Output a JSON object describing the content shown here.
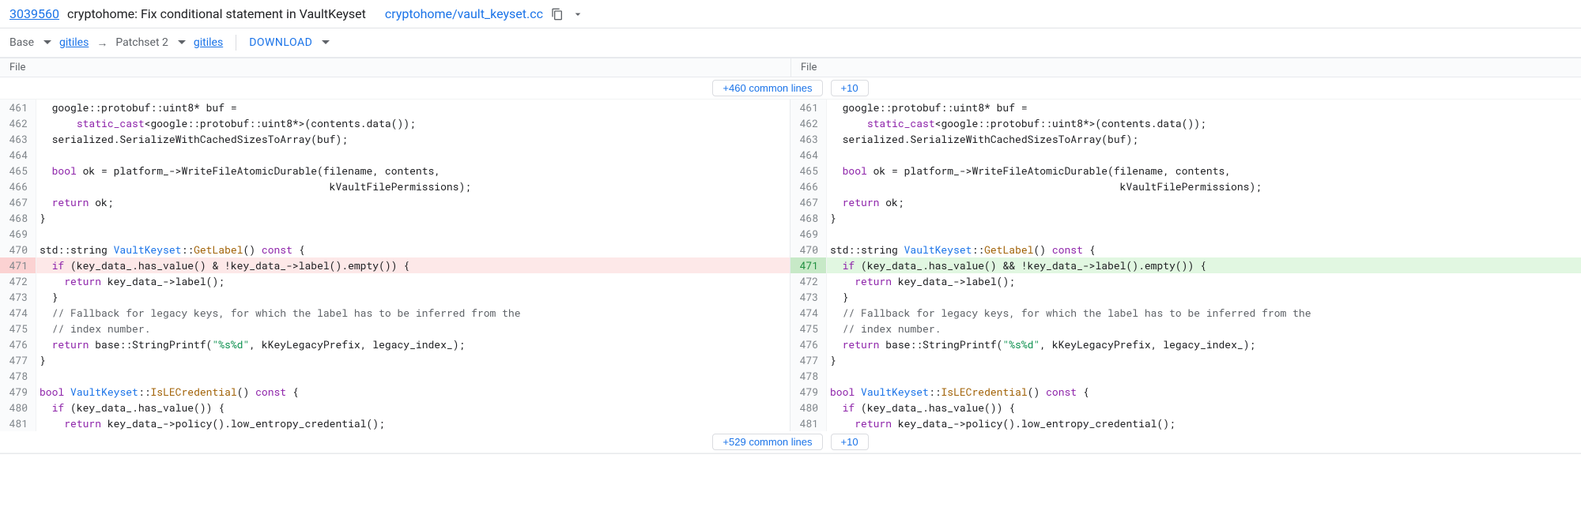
{
  "header": {
    "change_id": "3039560",
    "title": "cryptohome: Fix conditional statement in VaultKeyset",
    "file_path": "cryptohome/vault_keyset.cc"
  },
  "secondary": {
    "base_label": "Base",
    "gitiles_left": "gitiles",
    "arrow": "→",
    "patchset_label": "Patchset 2",
    "gitiles_right": "gitiles",
    "download": "DOWNLOAD"
  },
  "headings": {
    "left": "File",
    "right": "File"
  },
  "expand_top": {
    "common": "+460 common lines",
    "more": "+10"
  },
  "expand_bottom": {
    "common": "+529 common lines",
    "more": "+10"
  },
  "diff_left": [
    {
      "n": "461",
      "t": "none",
      "html": "  google::protobuf::uint8* buf ="
    },
    {
      "n": "462",
      "t": "none",
      "html": "      <span class='kw'>static_cast</span>&lt;google::protobuf::uint8*&gt;(contents.data());"
    },
    {
      "n": "463",
      "t": "none",
      "html": "  serialized.SerializeWithCachedSizesToArray(buf);"
    },
    {
      "n": "464",
      "t": "none",
      "html": ""
    },
    {
      "n": "465",
      "t": "none",
      "html": "  <span class='kw'>bool</span> ok = platform_-&gt;WriteFileAtomicDurable(filename, contents,"
    },
    {
      "n": "466",
      "t": "none",
      "html": "                                               kVaultFilePermissions);"
    },
    {
      "n": "467",
      "t": "none",
      "html": "  <span class='kw'>return</span> ok;"
    },
    {
      "n": "468",
      "t": "none",
      "html": "}"
    },
    {
      "n": "469",
      "t": "none",
      "html": ""
    },
    {
      "n": "470",
      "t": "none",
      "html": "std::string <span class='type'>VaultKeyset</span>::<span class='func'>GetLabel</span>() <span class='kw'>const</span> {"
    },
    {
      "n": "471",
      "t": "del",
      "html": "  <span class='kw'>if</span> (key_data_.has_value() &amp; !key_data_-&gt;label().empty()) {"
    },
    {
      "n": "472",
      "t": "none",
      "html": "    <span class='kw'>return</span> key_data_-&gt;label();"
    },
    {
      "n": "473",
      "t": "none",
      "html": "  }"
    },
    {
      "n": "474",
      "t": "none",
      "html": "  <span class='cmt'>// Fallback for legacy keys, for which the label has to be inferred from the</span>"
    },
    {
      "n": "475",
      "t": "none",
      "html": "  <span class='cmt'>// index number.</span>"
    },
    {
      "n": "476",
      "t": "none",
      "html": "  <span class='kw'>return</span> base::StringPrintf(<span class='str'>\"%s%d\"</span>, kKeyLegacyPrefix, legacy_index_);"
    },
    {
      "n": "477",
      "t": "none",
      "html": "}"
    },
    {
      "n": "478",
      "t": "none",
      "html": ""
    },
    {
      "n": "479",
      "t": "none",
      "html": "<span class='kw'>bool</span> <span class='type'>VaultKeyset</span>::<span class='func'>IsLECredential</span>() <span class='kw'>const</span> {"
    },
    {
      "n": "480",
      "t": "none",
      "html": "  <span class='kw'>if</span> (key_data_.has_value()) {"
    },
    {
      "n": "481",
      "t": "none",
      "html": "    <span class='kw'>return</span> key_data_-&gt;policy().low_entropy_credential();"
    }
  ],
  "diff_right": [
    {
      "n": "461",
      "t": "none",
      "html": "  google::protobuf::uint8* buf ="
    },
    {
      "n": "462",
      "t": "none",
      "html": "      <span class='kw'>static_cast</span>&lt;google::protobuf::uint8*&gt;(contents.data());"
    },
    {
      "n": "463",
      "t": "none",
      "html": "  serialized.SerializeWithCachedSizesToArray(buf);"
    },
    {
      "n": "464",
      "t": "none",
      "html": ""
    },
    {
      "n": "465",
      "t": "none",
      "html": "  <span class='kw'>bool</span> ok = platform_-&gt;WriteFileAtomicDurable(filename, contents,"
    },
    {
      "n": "466",
      "t": "none",
      "html": "                                               kVaultFilePermissions);"
    },
    {
      "n": "467",
      "t": "none",
      "html": "  <span class='kw'>return</span> ok;"
    },
    {
      "n": "468",
      "t": "none",
      "html": "}"
    },
    {
      "n": "469",
      "t": "none",
      "html": ""
    },
    {
      "n": "470",
      "t": "none",
      "html": "std::string <span class='type'>VaultKeyset</span>::<span class='func'>GetLabel</span>() <span class='kw'>const</span> {"
    },
    {
      "n": "471",
      "t": "add",
      "html": "  <span class='kw'>if</span> (key_data_.has_value() &amp;&amp; !key_data_-&gt;label().empty()) {"
    },
    {
      "n": "472",
      "t": "none",
      "html": "    <span class='kw'>return</span> key_data_-&gt;label();"
    },
    {
      "n": "473",
      "t": "none",
      "html": "  }"
    },
    {
      "n": "474",
      "t": "none",
      "html": "  <span class='cmt'>// Fallback for legacy keys, for which the label has to be inferred from the</span>"
    },
    {
      "n": "475",
      "t": "none",
      "html": "  <span class='cmt'>// index number.</span>"
    },
    {
      "n": "476",
      "t": "none",
      "html": "  <span class='kw'>return</span> base::StringPrintf(<span class='str'>\"%s%d\"</span>, kKeyLegacyPrefix, legacy_index_);"
    },
    {
      "n": "477",
      "t": "none",
      "html": "}"
    },
    {
      "n": "478",
      "t": "none",
      "html": ""
    },
    {
      "n": "479",
      "t": "none",
      "html": "<span class='kw'>bool</span> <span class='type'>VaultKeyset</span>::<span class='func'>IsLECredential</span>() <span class='kw'>const</span> {"
    },
    {
      "n": "480",
      "t": "none",
      "html": "  <span class='kw'>if</span> (key_data_.has_value()) {"
    },
    {
      "n": "481",
      "t": "none",
      "html": "    <span class='kw'>return</span> key_data_-&gt;policy().low_entropy_credential();"
    }
  ]
}
